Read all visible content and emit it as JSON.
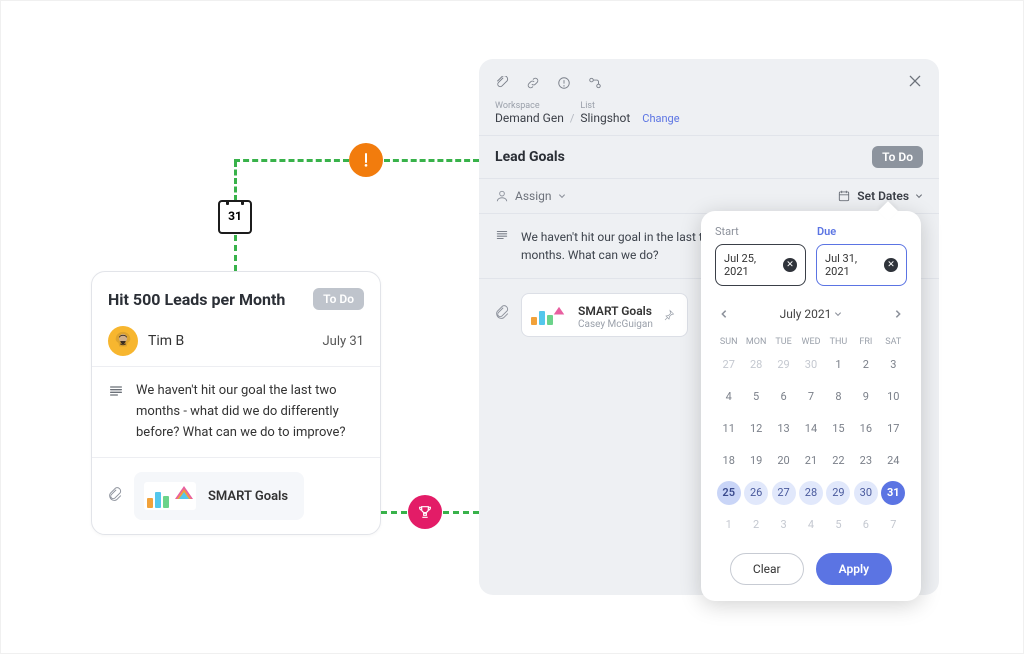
{
  "card": {
    "title": "Hit 500 Leads per Month",
    "status": "To Do",
    "assignee": "Tim B",
    "due_display": "July 31",
    "description": "We haven't hit our goal the last two months - what did we do differently before? What can we do to improve?",
    "attachment_name": "SMART Goals"
  },
  "calendar_icon_day": "31",
  "panel": {
    "crumbs": {
      "workspace_label": "Workspace",
      "workspace_value": "Demand Gen",
      "list_label": "List",
      "list_value": "Slingshot",
      "change": "Change"
    },
    "title": "Lead Goals",
    "status": "To Do",
    "assign_label": "Assign",
    "set_dates_label": "Set Dates",
    "note": "We haven't hit our goal in the last two months. What can we do?",
    "attachment": {
      "name": "SMART Goals",
      "owner": "Casey McGuigan"
    }
  },
  "picker": {
    "start_label": "Start",
    "due_label": "Due",
    "start_value": "Jul 25, 2021",
    "due_value": "Jul 31, 2021",
    "month_label": "July 2021",
    "dow": [
      "SUN",
      "MON",
      "TUE",
      "WED",
      "THU",
      "FRI",
      "SAT"
    ],
    "lead_out": [
      27,
      28,
      29,
      30
    ],
    "days": [
      1,
      2,
      3,
      4,
      5,
      6,
      7,
      8,
      9,
      10,
      11,
      12,
      13,
      14,
      15,
      16,
      17,
      18,
      19,
      20,
      21,
      22,
      23,
      24,
      25,
      26,
      27,
      28,
      29,
      30,
      31
    ],
    "trail_out": [
      1,
      2,
      3,
      4,
      5,
      6,
      7
    ],
    "range_start": 25,
    "range_end": 31,
    "clear": "Clear",
    "apply": "Apply"
  }
}
